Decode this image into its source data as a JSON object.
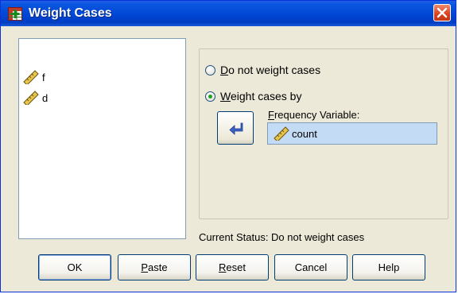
{
  "window": {
    "title": "Weight Cases"
  },
  "variables": [
    {
      "name": "f",
      "icon": "ruler-icon"
    },
    {
      "name": "d",
      "icon": "ruler-icon"
    }
  ],
  "options": {
    "do_not_weight": {
      "prefix": "",
      "accel": "D",
      "rest": "o not weight cases",
      "selected": false
    },
    "weight_by": {
      "prefix": "",
      "accel": "W",
      "rest": "eight cases by",
      "selected": true
    }
  },
  "frequency": {
    "label_accel": "F",
    "label_rest": "requency Variable:",
    "value": "count",
    "icon": "ruler-icon"
  },
  "status": "Current Status: Do not weight cases",
  "buttons": {
    "ok": {
      "label": "OK"
    },
    "paste": {
      "accel": "P",
      "rest": "aste"
    },
    "reset": {
      "accel": "R",
      "rest": "eset"
    },
    "cancel": {
      "label": "Cancel"
    },
    "help": {
      "label": "Help"
    }
  },
  "colors": {
    "titlebar": "#0046d5",
    "selection": "#c3dbf4",
    "dialog_bg": "#ece9d8"
  }
}
